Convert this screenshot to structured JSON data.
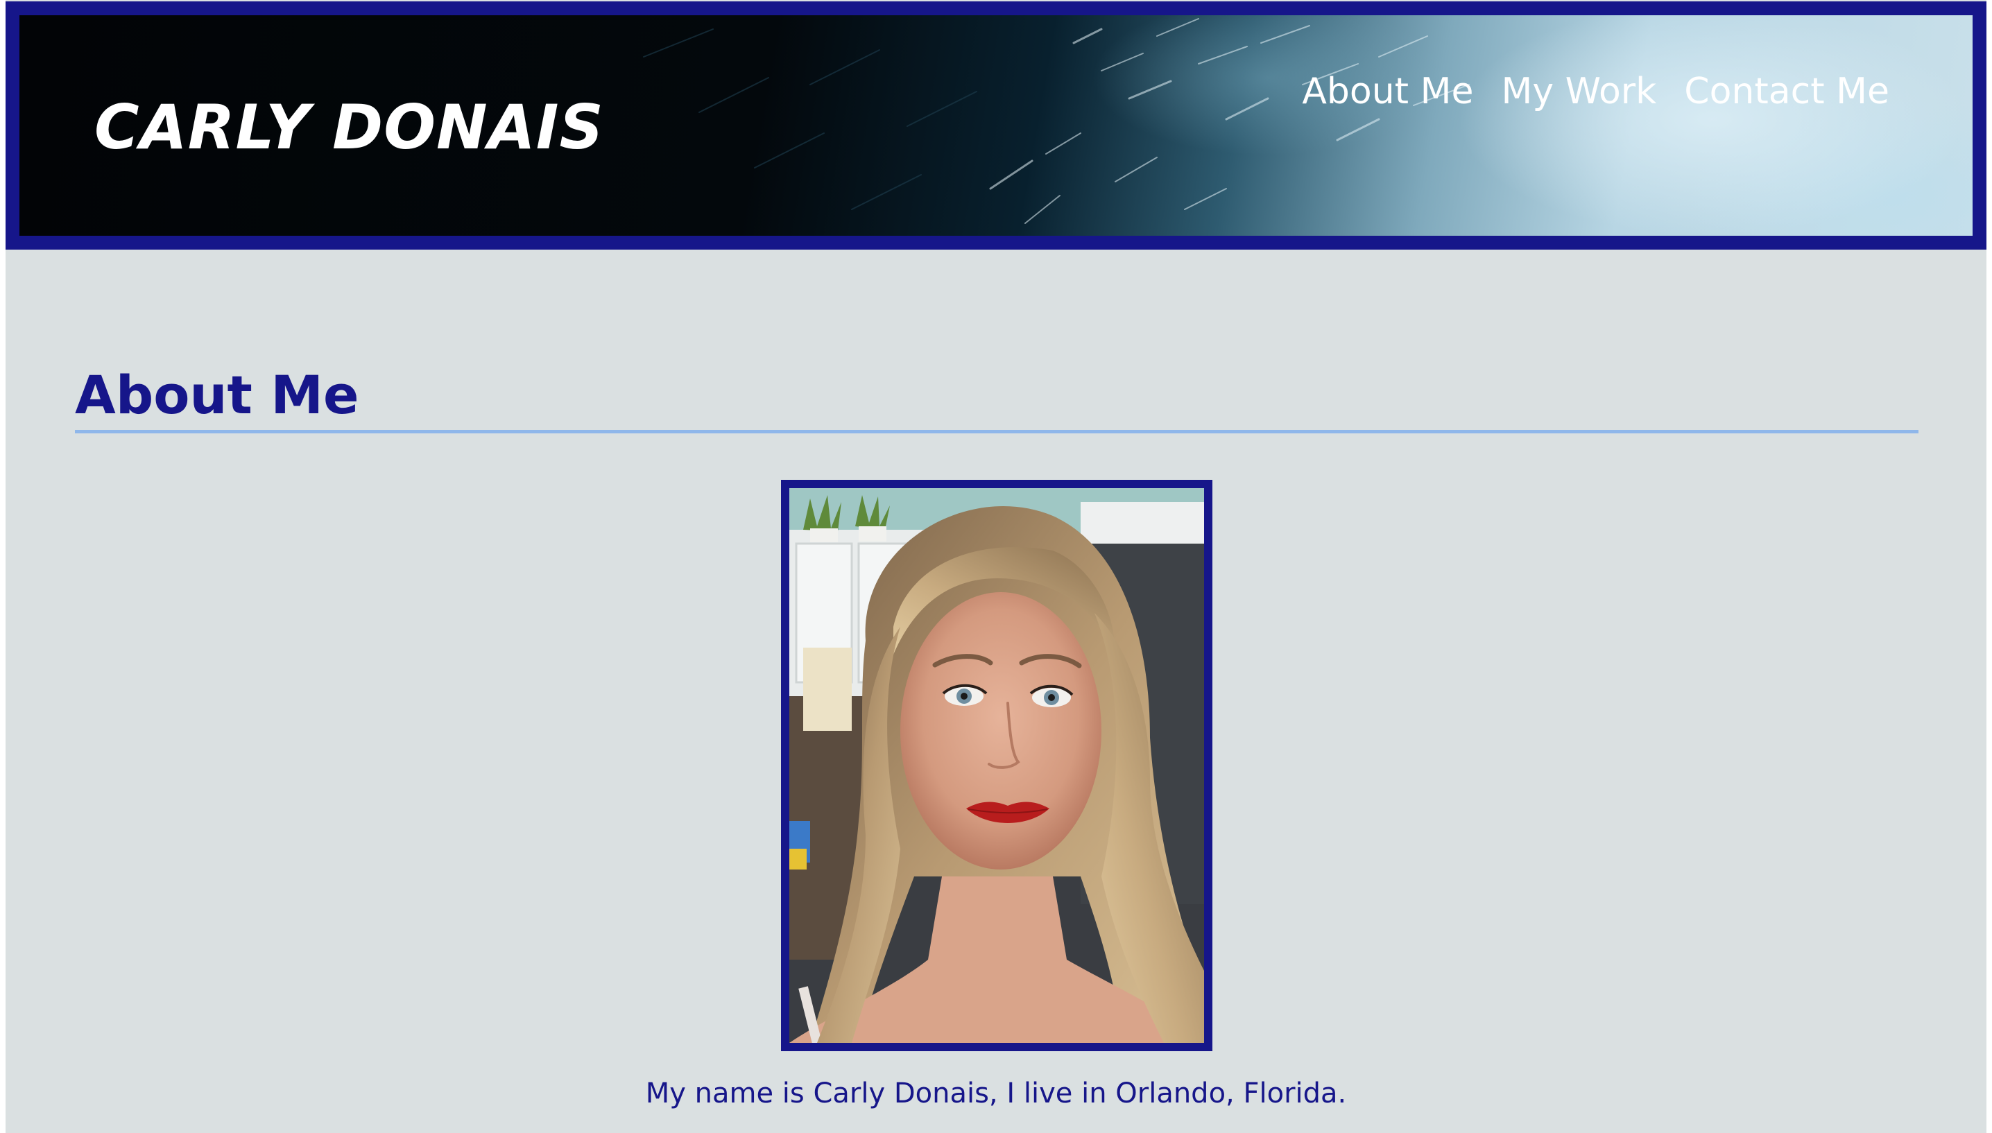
{
  "header": {
    "site_title": "CARLY DONAIS",
    "nav": [
      {
        "label": "About Me"
      },
      {
        "label": "My Work"
      },
      {
        "label": "Contact Me"
      }
    ]
  },
  "main": {
    "heading": "About Me",
    "caption": "My name is Carly Donais, I live in Orlando, Florida."
  },
  "colors": {
    "page_background": "#dae0e1",
    "brand_navy": "#16168a",
    "heading_rule": "#8fb7ea"
  }
}
